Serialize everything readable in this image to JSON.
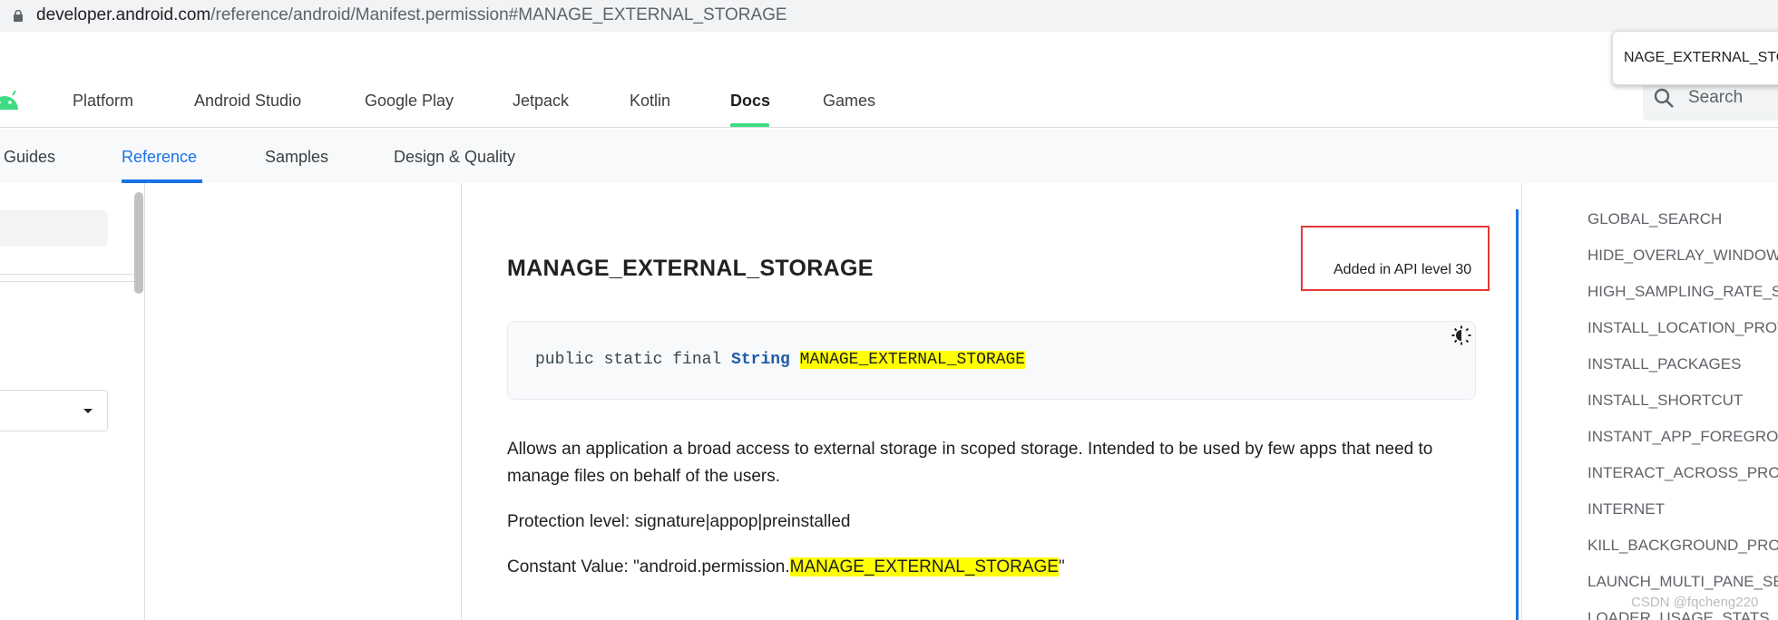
{
  "browser": {
    "url_host": "developer.android.com",
    "url_path": "/reference/android/Manifest.permission#MANAGE_EXTERNAL_STORAGE"
  },
  "find_bar": {
    "text": "NAGE_EXTERNAL_STO"
  },
  "top_nav": {
    "items": [
      {
        "label": "Platform"
      },
      {
        "label": "Android Studio"
      },
      {
        "label": "Google Play"
      },
      {
        "label": "Jetpack"
      },
      {
        "label": "Kotlin"
      },
      {
        "label": "Docs"
      },
      {
        "label": "Games"
      }
    ],
    "active": "Docs",
    "search_placeholder": "Search"
  },
  "sub_nav": {
    "items": [
      {
        "label": "Guides"
      },
      {
        "label": "Reference"
      },
      {
        "label": "Samples"
      },
      {
        "label": "Design & Quality"
      }
    ],
    "active": "Reference"
  },
  "main": {
    "title": "MANAGE_EXTERNAL_STORAGE",
    "api_level": "Added in API level 30",
    "code": {
      "modifiers": "public static final",
      "type": "String",
      "name": "MANAGE_EXTERNAL_STORAGE"
    },
    "description": "Allows an application a broad access to external storage in scoped storage. Intended to be used by few apps that need to manage files on behalf of the users.",
    "protection_level": "Protection level: signature|appop|preinstalled",
    "constant_prefix": "Constant Value: \"android.permission.",
    "constant_name": "MANAGE_EXTERNAL_STORAGE",
    "constant_suffix": "\""
  },
  "toc": {
    "items": [
      "GLOBAL_SEARCH",
      "HIDE_OVERLAY_WINDOWS",
      "HIGH_SAMPLING_RATE_SE",
      "INSTALL_LOCATION_PROV",
      "INSTALL_PACKAGES",
      "INSTALL_SHORTCUT",
      "INSTANT_APP_FOREGROU",
      "INTERACT_ACROSS_PROFI",
      "INTERNET",
      "KILL_BACKGROUND_PROC",
      "LAUNCH_MULTI_PANE_SE",
      "LOADER_USAGE_STATS"
    ]
  },
  "watermark": "CSDN @fqcheng220",
  "colors": {
    "accent_blue": "#1a73e8",
    "android_green": "#3ddc84",
    "highlight_yellow": "#ffff00",
    "annotation_red": "#e53935"
  },
  "icons": [
    "lock-icon",
    "android-logo-icon",
    "search-icon",
    "theme-toggle-icon",
    "dropdown-caret-icon"
  ]
}
